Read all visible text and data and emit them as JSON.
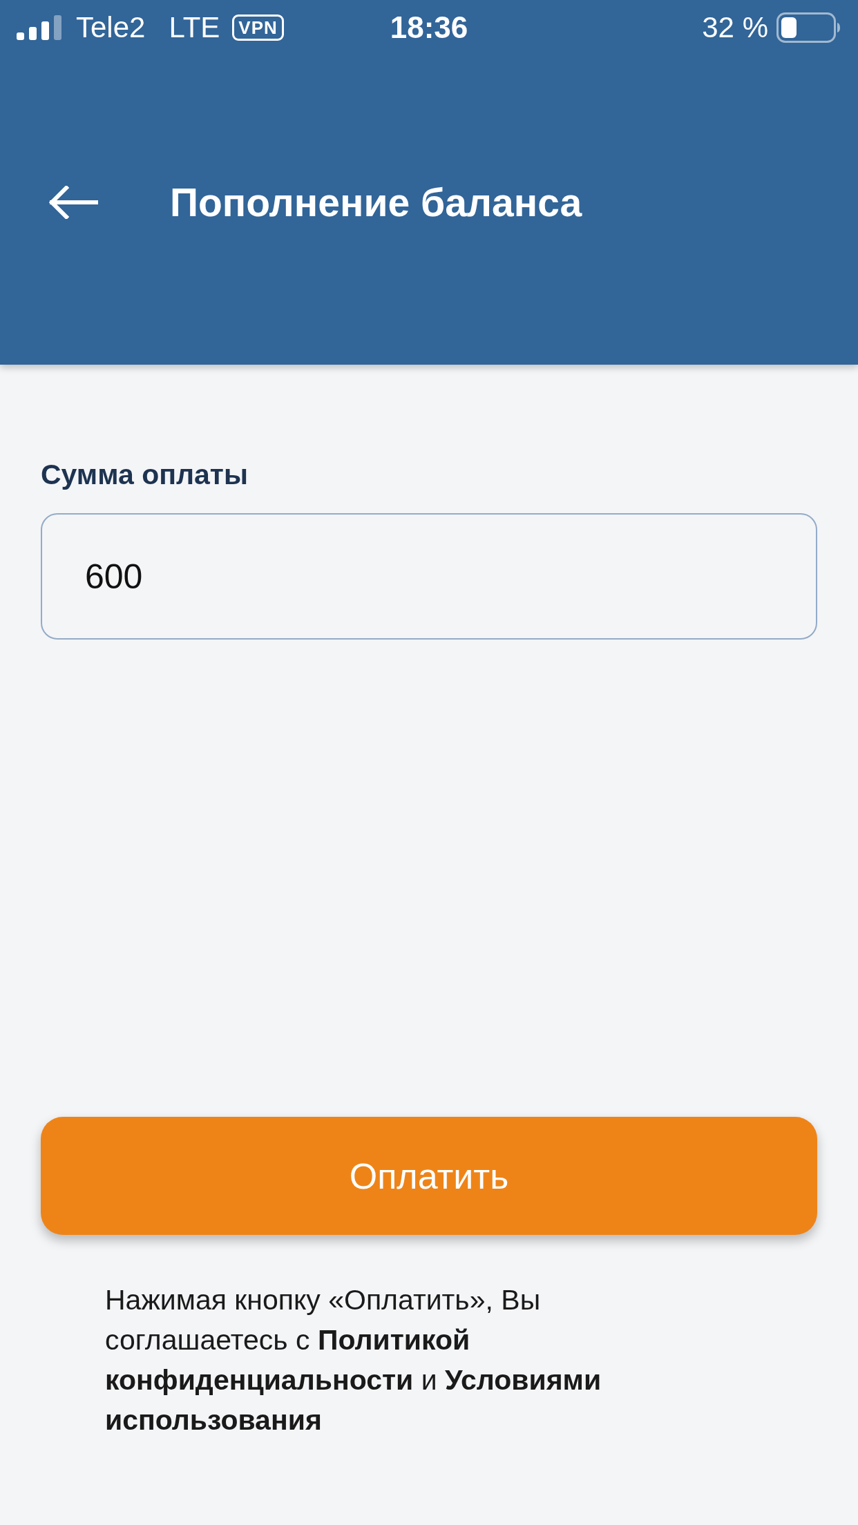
{
  "status_bar": {
    "carrier": "Tele2",
    "network": "LTE",
    "vpn_badge": "VPN",
    "time": "18:36",
    "battery_percent": "32 %"
  },
  "header": {
    "title": "Пополнение баланса"
  },
  "form": {
    "amount_label": "Сумма оплаты",
    "amount_field": {
      "value": "600"
    }
  },
  "pay_button": {
    "label": "Оплатить"
  },
  "consent_text": "Нажимая кнопку «Оплатить», Вы соглашаетесь с **Политикой конфиденциальности** и **Условиями использования**"
}
